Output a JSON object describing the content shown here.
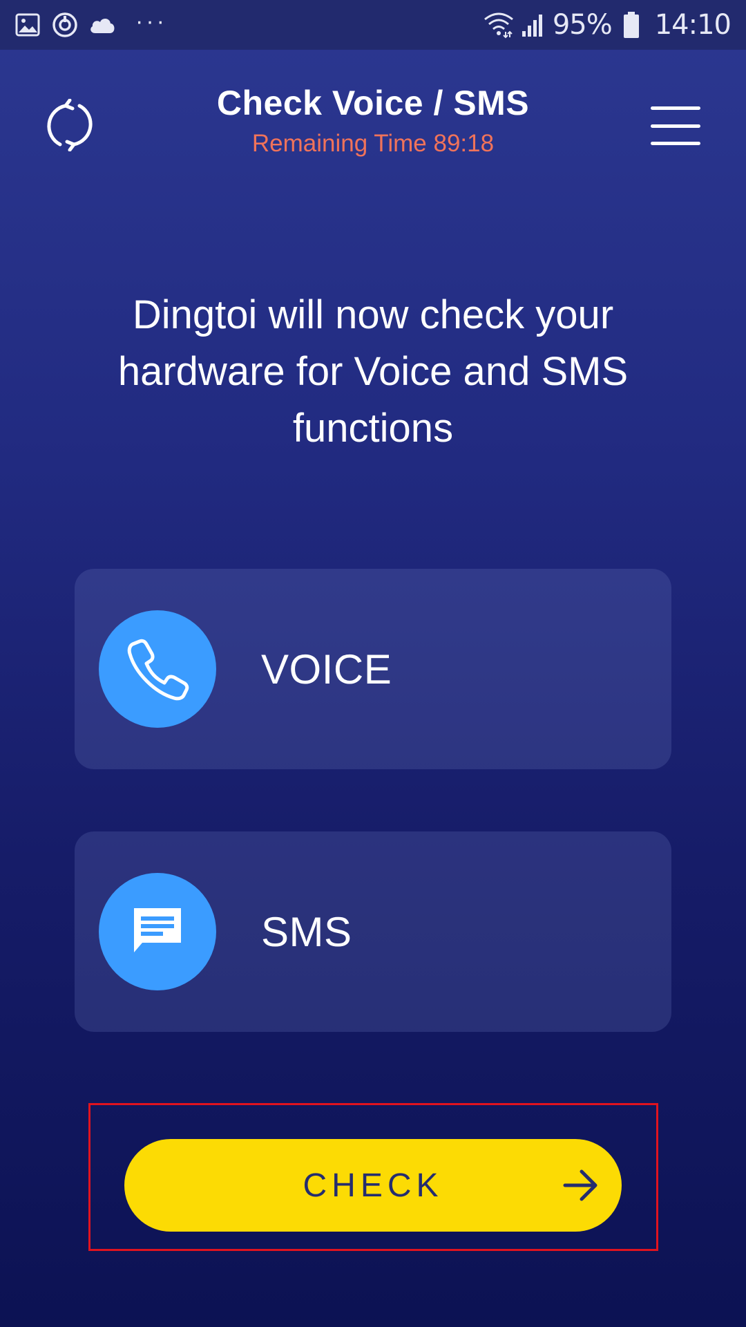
{
  "status_bar": {
    "left_icons": [
      "image-icon",
      "sync-timer-icon",
      "cloud-icon"
    ],
    "overflow_dots": "···",
    "wifi_icon": "wifi-icon",
    "signal_icon": "signal-icon",
    "battery_percent": "95%",
    "battery_icon": "battery-icon",
    "time": "14:10"
  },
  "header": {
    "title": "Check Voice / SMS",
    "remaining_time": "Remaining Time 89:18",
    "left_button_icon": "refresh-icon",
    "right_button_icon": "menu-icon"
  },
  "intro": {
    "lines": [
      "Dingtoi will now check your",
      "hardware for Voice and SMS",
      "functions"
    ]
  },
  "cards": [
    {
      "label": "VOICE",
      "icon": "phone-icon"
    },
    {
      "label": "SMS",
      "icon": "message-icon"
    }
  ],
  "check_button": {
    "label": "CHECK",
    "icon": "arrow-right-icon"
  },
  "colors": {
    "accent_yellow": "#fcdb04",
    "icon_blue": "#3b9cff",
    "timer_orange": "#f0735a",
    "highlight_red": "#e0131f"
  }
}
